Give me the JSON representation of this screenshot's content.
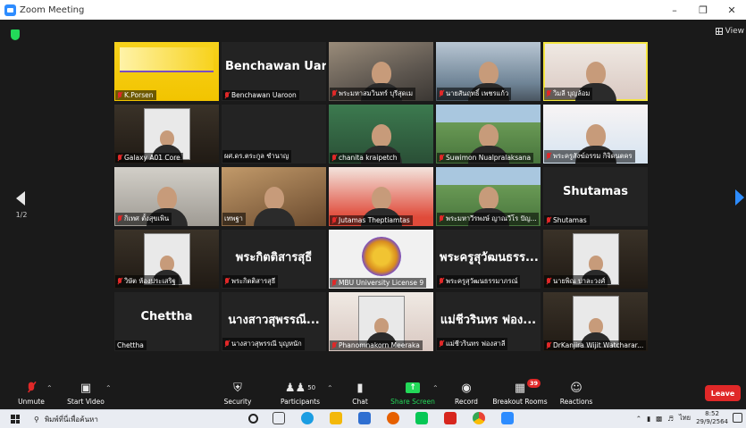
{
  "window": {
    "title": "Zoom Meeting",
    "view_label": "View"
  },
  "pager": {
    "left": "1/2"
  },
  "tiles": [
    {
      "name": "K.Porsen",
      "muted": true,
      "big": "",
      "bg": "bg-yellow",
      "kind": "slide"
    },
    {
      "name": "Benchawan Uaroon",
      "muted": true,
      "big": "Benchawan Uar...",
      "bg": "",
      "kind": "name"
    },
    {
      "name": "พระมหาสมวินทร์ บุรีสุดเม",
      "muted": true,
      "big": "",
      "bg": "bg-room",
      "kind": "person"
    },
    {
      "name": "นายสันฤทธิ์ เพชรแก้ว",
      "muted": true,
      "big": "",
      "bg": "bg-blue",
      "kind": "person"
    },
    {
      "name": "วิมลี บุญล้อม",
      "muted": true,
      "big": "",
      "bg": "bg-light",
      "kind": "person",
      "active": true
    },
    {
      "name": "Galaxy A01 Core",
      "muted": true,
      "big": "",
      "bg": "bg-dark",
      "kind": "thumb"
    },
    {
      "name": "ผศ.ดร.ตระกูล ชำนาญ",
      "muted": false,
      "big": "",
      "bg": "",
      "kind": "empty"
    },
    {
      "name": "chanita kraipetch",
      "muted": true,
      "big": "",
      "bg": "bg-green",
      "kind": "person"
    },
    {
      "name": "Suwimon Nualpralaksana",
      "muted": true,
      "big": "",
      "bg": "bg-field",
      "kind": "person"
    },
    {
      "name": "พระครูสังฆ์อรรม กิจิดนตคร",
      "muted": true,
      "big": "",
      "bg": "bg-slide",
      "kind": "person"
    },
    {
      "name": "กิเทศ ตั้งสุขเพิน",
      "muted": true,
      "big": "",
      "bg": "bg-office",
      "kind": "person"
    },
    {
      "name": "เทพฐา",
      "muted": false,
      "big": "",
      "bg": "bg-warm",
      "kind": "person"
    },
    {
      "name": "Jutamas Theptiamtas",
      "muted": true,
      "big": "",
      "bg": "bg-red",
      "kind": "person"
    },
    {
      "name": "พระมหาวีรพงษ์ ญาณวีโร ปัญ...",
      "muted": true,
      "big": "",
      "bg": "bg-field",
      "kind": "person"
    },
    {
      "name": "Shutamas",
      "muted": true,
      "big": "Shutamas",
      "bg": "",
      "kind": "name"
    },
    {
      "name": "วิษัต ห้องประเสริฐ",
      "muted": true,
      "big": "",
      "bg": "bg-dark",
      "kind": "thumb"
    },
    {
      "name": "พระกิตติสารสุธี",
      "muted": true,
      "big": "พระกิตติสารสุธี",
      "bg": "",
      "kind": "name"
    },
    {
      "name": "MBU University License 9",
      "muted": true,
      "big": "",
      "bg": "bg-logo",
      "kind": "logo"
    },
    {
      "name": "พระครูสุวัฒนธรรมาภรณ์",
      "muted": true,
      "big": "พระครูสุวัฒนธรร...",
      "bg": "",
      "kind": "name"
    },
    {
      "name": "นายพิณ ปาละวงศ์",
      "muted": true,
      "big": "",
      "bg": "bg-dark",
      "kind": "thumb"
    },
    {
      "name": "Chettha",
      "muted": false,
      "big": "Chettha",
      "bg": "",
      "kind": "name"
    },
    {
      "name": "นางสาวสุพรรณี บุญหนัก",
      "muted": true,
      "big": "นางสาวสุพรรณี...",
      "bg": "",
      "kind": "name"
    },
    {
      "name": "Phanomnakorn Meeraka",
      "muted": true,
      "big": "",
      "bg": "bg-light",
      "kind": "thumb"
    },
    {
      "name": "แม่ชีวรินทร ฟองสาลี",
      "muted": true,
      "big": "แม่ชีวรินทร ฟอง...",
      "bg": "",
      "kind": "name"
    },
    {
      "name": "DrKanjira Wijit Watcharar...",
      "muted": true,
      "big": "",
      "bg": "bg-dark",
      "kind": "thumb"
    }
  ],
  "toolbar": {
    "unmute": "Unmute",
    "start_video": "Start Video",
    "security": "Security",
    "participants": "Participants",
    "participants_count": "50",
    "chat": "Chat",
    "share_screen": "Share Screen",
    "record": "Record",
    "breakout": "Breakout Rooms",
    "breakout_badge": "39",
    "reactions": "Reactions",
    "leave": "Leave"
  },
  "taskbar": {
    "search_placeholder": "พิมพ์ที่นี่เพื่อค้นหา",
    "lang": "ไทย",
    "time": "8:52",
    "date": "29/9/2564"
  },
  "colors": {
    "accent": "#2d8cff",
    "leave": "#e02828",
    "share": "#23d959",
    "active_speaker": "#f5e642"
  }
}
